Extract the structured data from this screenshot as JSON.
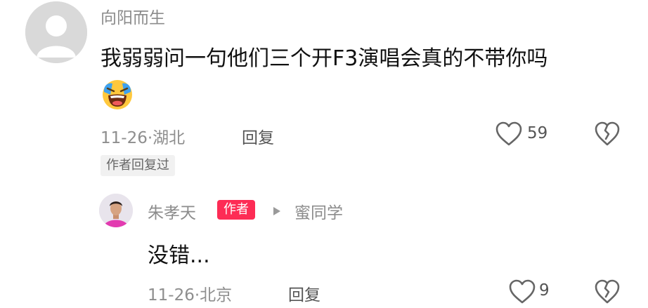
{
  "comment": {
    "username": "向阳而生",
    "text": "我弱弱问一句他们三个开F3演唱会真的不带你吗",
    "emoji": "laughing-crying-emoji",
    "date": "11-26",
    "separator": "·",
    "location": "湖北",
    "reply_label": "回复",
    "like_count": "59",
    "author_replied_tag": "作者回复过"
  },
  "reply": {
    "username": "朱孝天",
    "author_badge": "作者",
    "reply_to": "蜜同学",
    "text": "没错...",
    "date": "11-26",
    "separator": "·",
    "location": "北京",
    "reply_label": "回复",
    "like_count": "9"
  },
  "colors": {
    "author_badge_bg": "#fd2c55",
    "meta_text": "#8e8e8e",
    "body_text": "#111111"
  }
}
